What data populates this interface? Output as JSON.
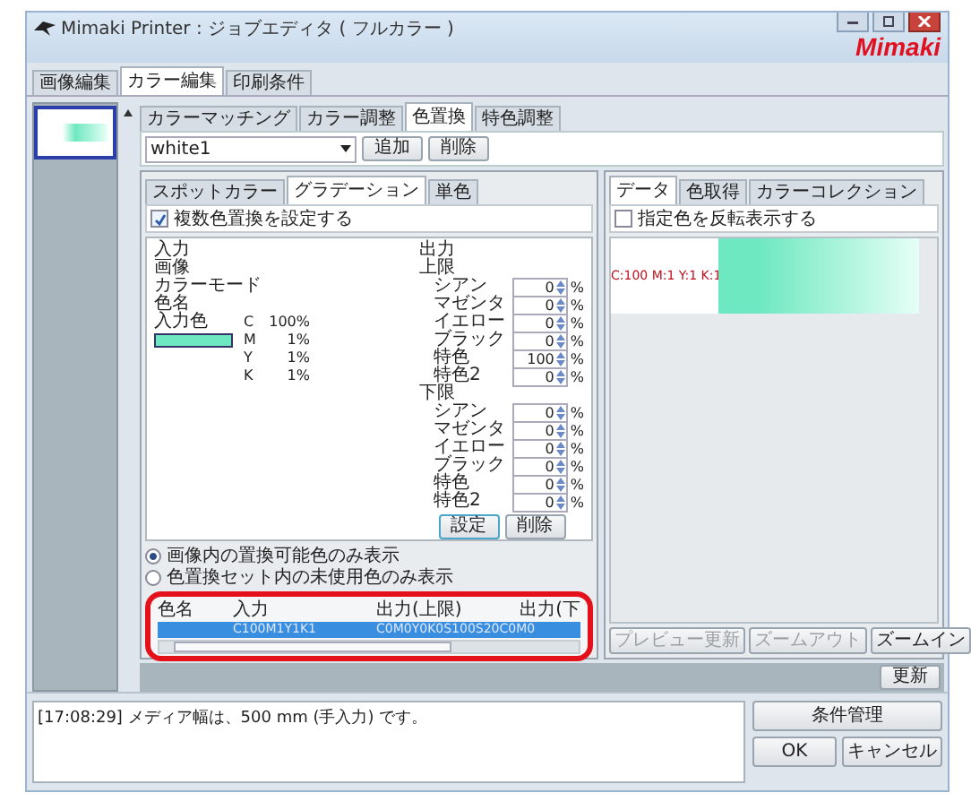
{
  "window": {
    "title": "Mimaki Printer : ジョブエディタ ( フルカラー )",
    "logo": "Mimaki"
  },
  "main_tabs": [
    {
      "label": "画像編集",
      "selected": false
    },
    {
      "label": "カラー編集",
      "selected": true
    },
    {
      "label": "印刷条件",
      "selected": false
    }
  ],
  "thumbnails": [
    {
      "selected": true
    }
  ],
  "sub_tabs": [
    {
      "label": "カラーマッチング",
      "selected": false
    },
    {
      "label": "カラー調整",
      "selected": false
    },
    {
      "label": "色置換",
      "selected": true
    },
    {
      "label": "特色調整",
      "selected": false
    }
  ],
  "replacement_set": {
    "value": "white1",
    "buttons": [
      "追加",
      "削除"
    ]
  },
  "mode_tabs": [
    {
      "label": "スポットカラー",
      "selected": false
    },
    {
      "label": "グラデーション",
      "selected": true
    },
    {
      "label": "単色",
      "selected": false
    }
  ],
  "multi_replace": {
    "label": "複数色置換を設定する",
    "checked": true
  },
  "input": {
    "heading": "入力",
    "labels": [
      "画像",
      "カラーモード",
      "色名"
    ],
    "color_label": "入力色",
    "values": [
      {
        "channel": "C",
        "value": "100%"
      },
      {
        "channel": "M",
        "value": "1%"
      },
      {
        "channel": "Y",
        "value": "1%"
      },
      {
        "channel": "K",
        "value": "1%"
      }
    ]
  },
  "output": {
    "heading": "出力",
    "groups": [
      {
        "title": "上限",
        "rows": [
          {
            "label": "シアン",
            "value": "0",
            "unit": "%"
          },
          {
            "label": "マゼンタ",
            "value": "0",
            "unit": "%"
          },
          {
            "label": "イエロー",
            "value": "0",
            "unit": "%"
          },
          {
            "label": "ブラック",
            "value": "0",
            "unit": "%"
          },
          {
            "label": "特色",
            "value": "100",
            "unit": "%"
          },
          {
            "label": "特色2",
            "value": "0",
            "unit": "%"
          }
        ]
      },
      {
        "title": "下限",
        "rows": [
          {
            "label": "シアン",
            "value": "0",
            "unit": "%"
          },
          {
            "label": "マゼンタ",
            "value": "0",
            "unit": "%"
          },
          {
            "label": "イエロー",
            "value": "0",
            "unit": "%"
          },
          {
            "label": "ブラック",
            "value": "0",
            "unit": "%"
          },
          {
            "label": "特色",
            "value": "0",
            "unit": "%"
          },
          {
            "label": "特色2",
            "value": "0",
            "unit": "%"
          }
        ]
      }
    ]
  },
  "edit_buttons": [
    "設定",
    "削除"
  ],
  "filters": [
    {
      "label": "画像内の置換可能色のみ表示",
      "selected": true
    },
    {
      "label": "色置換セット内の未使用色のみ表示",
      "selected": false
    }
  ],
  "table": {
    "columns": [
      "色名",
      "入力",
      "出力(上限)",
      "出力(下"
    ],
    "rows": [
      {
        "selected": true,
        "input": "C100M1Y1K1",
        "output_upper": "C0M0Y0K0S100S20C0M0"
      }
    ]
  },
  "preview_tabs": [
    {
      "label": "データ",
      "selected": true
    },
    {
      "label": "色取得",
      "selected": false
    },
    {
      "label": "カラーコレクション",
      "selected": false
    }
  ],
  "invert": {
    "label": "指定色を反転表示する",
    "checked": false
  },
  "preview": {
    "sample": "C:100 M:1 Y:1 K:1"
  },
  "preview_buttons": [
    {
      "label": "プレビュー更新",
      "disabled": true
    },
    {
      "label": "ズームアウト",
      "disabled": true
    },
    {
      "label": "ズームイン",
      "disabled": false
    }
  ],
  "update_button": "更新",
  "log": {
    "lines": [
      "[17:08:29] メディア幅は、500 mm (手入力) です。"
    ]
  },
  "condition_button": "条件管理",
  "dialog_buttons": [
    "OK",
    "キャンセル"
  ]
}
